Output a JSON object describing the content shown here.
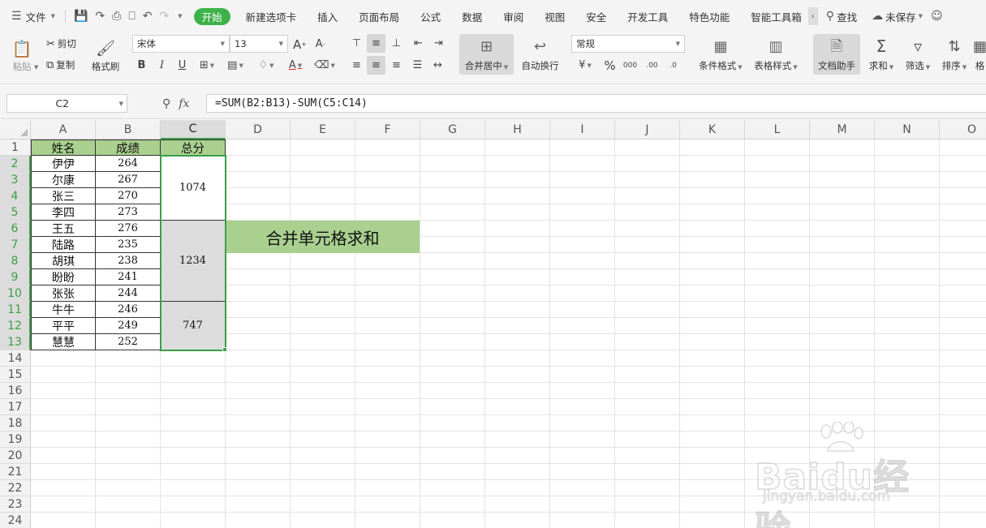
{
  "menubar": {
    "file_label": "文件",
    "tabs": [
      {
        "label": "开始",
        "active": true
      },
      {
        "label": "新建选项卡"
      },
      {
        "label": "插入"
      },
      {
        "label": "页面布局"
      },
      {
        "label": "公式"
      },
      {
        "label": "数据"
      },
      {
        "label": "审阅"
      },
      {
        "label": "视图"
      },
      {
        "label": "安全"
      },
      {
        "label": "开发工具"
      },
      {
        "label": "特色功能"
      },
      {
        "label": "智能工具箱"
      }
    ],
    "search_label": "查找",
    "save_status": "未保存",
    "accent_color": "#3eb24a"
  },
  "ribbon": {
    "paste": "粘贴",
    "cut": "剪切",
    "copy": "复制",
    "format_painter": "格式刷",
    "font_name": "宋体",
    "font_size": "13",
    "merge_center": "合并居中",
    "wrap_text": "自动换行",
    "number_format": "常规",
    "conditional_format": "条件格式",
    "table_style": "表格样式",
    "doc_assistant": "文档助手",
    "sum": "求和",
    "filter": "筛选",
    "sort": "排序",
    "format_cut": "格"
  },
  "formula_bar": {
    "name_box": "C2",
    "fx_label": "fx",
    "formula": "=SUM(B2:B13)-SUM(C5:C14)"
  },
  "sheet": {
    "columns": [
      "A",
      "B",
      "C",
      "D",
      "E",
      "F",
      "G",
      "H",
      "I",
      "J",
      "K",
      "L",
      "M",
      "N",
      "O"
    ],
    "rows": [
      "1",
      "2",
      "3",
      "4",
      "5",
      "6",
      "7",
      "8",
      "9",
      "10",
      "11",
      "12",
      "13",
      "14",
      "15",
      "16",
      "17",
      "18",
      "19",
      "20",
      "21",
      "22",
      "23",
      "24"
    ],
    "selected_column": "C",
    "selected_rows": [
      "2",
      "3",
      "4",
      "5",
      "6",
      "7",
      "8",
      "9",
      "10",
      "11",
      "12",
      "13"
    ],
    "header": {
      "name": "姓名",
      "score": "成绩",
      "total": "总分"
    },
    "records": [
      {
        "name": "伊伊",
        "score": "264"
      },
      {
        "name": "尔康",
        "score": "267"
      },
      {
        "name": "张三",
        "score": "270"
      },
      {
        "name": "李四",
        "score": "273"
      },
      {
        "name": "王五",
        "score": "276"
      },
      {
        "name": "陆路",
        "score": "235"
      },
      {
        "name": "胡琪",
        "score": "238"
      },
      {
        "name": "盼盼",
        "score": "241"
      },
      {
        "name": "张张",
        "score": "244"
      },
      {
        "name": "牛牛",
        "score": "246"
      },
      {
        "name": "平平",
        "score": "249"
      },
      {
        "name": "慧慧",
        "score": "252"
      }
    ],
    "merged_totals": [
      {
        "value": "1074",
        "rows": "2-5"
      },
      {
        "value": "1234",
        "rows": "6-10"
      },
      {
        "value": "747",
        "rows": "11-13"
      }
    ],
    "title_text": "合并单元格求和",
    "header_fill": "#a9d08e",
    "selection_color": "#3c9e47"
  },
  "watermark": {
    "brand": "Baidu经验",
    "url": "jingyan.baidu.com"
  }
}
